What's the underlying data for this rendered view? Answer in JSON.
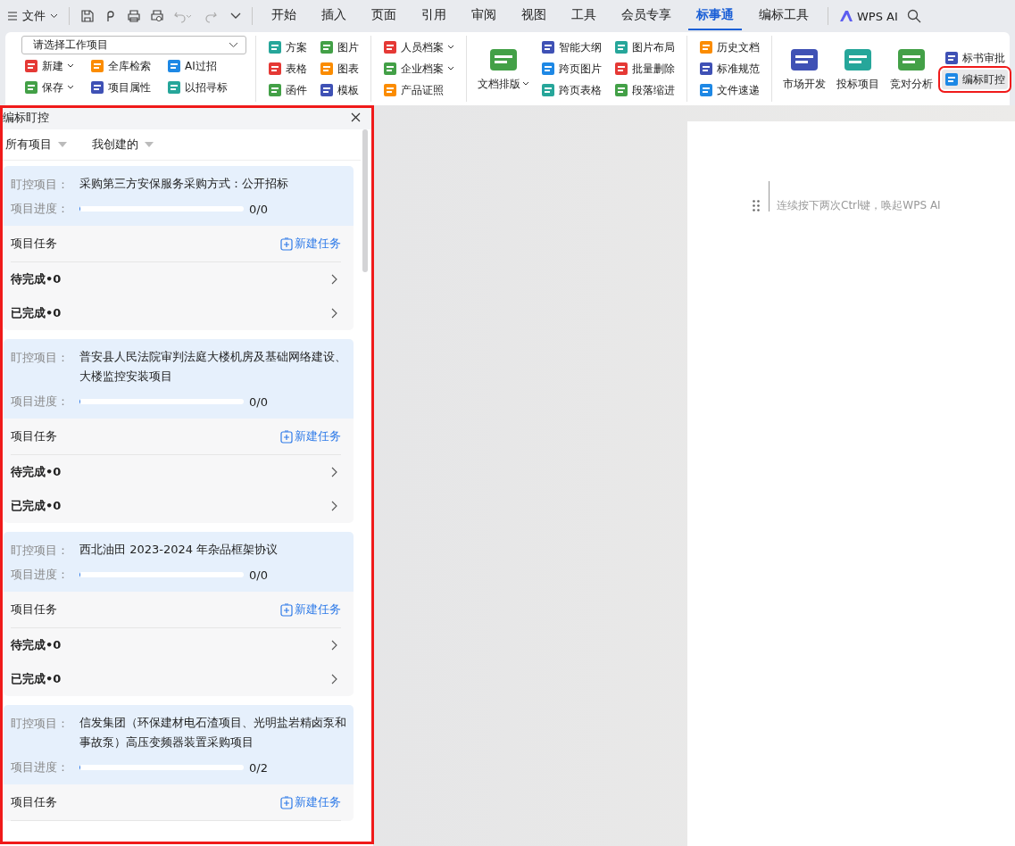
{
  "menu_bar": {
    "file_menu": "文件",
    "tabs": [
      {
        "label": "开始",
        "selected": false
      },
      {
        "label": "插入",
        "selected": false
      },
      {
        "label": "页面",
        "selected": false
      },
      {
        "label": "引用",
        "selected": false
      },
      {
        "label": "审阅",
        "selected": false
      },
      {
        "label": "视图",
        "selected": false
      },
      {
        "label": "工具",
        "selected": false
      },
      {
        "label": "会员专享",
        "selected": false
      },
      {
        "label": "标事通",
        "selected": true
      },
      {
        "label": "编标工具",
        "selected": false
      }
    ],
    "ai_button": "WPS AI"
  },
  "ribbon": {
    "groups": [
      {
        "columns": [
          [
            {
              "kind": "select",
              "label": "请选择工作项目"
            }
          ],
          [
            {
              "kind": "small",
              "label": "新建",
              "dropdown": true
            },
            {
              "kind": "small",
              "label": "保存",
              "dropdown": true
            }
          ],
          [
            {
              "kind": "small",
              "label": "全库检索",
              "dropdown": false
            },
            {
              "kind": "small",
              "label": "项目属性",
              "dropdown": false
            }
          ],
          [
            {
              "kind": "small",
              "label": "AI过招",
              "dropdown": false
            },
            {
              "kind": "small",
              "label": "以招寻标",
              "dropdown": false
            }
          ]
        ]
      },
      {
        "columns": [
          [
            {
              "kind": "small",
              "label": "方案",
              "dropdown": false
            },
            {
              "kind": "small",
              "label": "表格",
              "dropdown": false
            },
            {
              "kind": "small",
              "label": "函件",
              "dropdown": false
            }
          ],
          [
            {
              "kind": "small",
              "label": "图片",
              "dropdown": false
            },
            {
              "kind": "small",
              "label": "图表",
              "dropdown": false
            },
            {
              "kind": "small",
              "label": "模板",
              "dropdown": false
            }
          ]
        ]
      },
      {
        "columns": [
          [
            {
              "kind": "small",
              "label": "人员档案",
              "dropdown": true
            },
            {
              "kind": "small",
              "label": "企业档案",
              "dropdown": true
            },
            {
              "kind": "small",
              "label": "产品证照",
              "dropdown": false
            }
          ]
        ]
      },
      {
        "columns": [
          [
            {
              "kind": "big",
              "label": "文档排版",
              "dropdown": true,
              "selected": false
            }
          ],
          [
            {
              "kind": "small",
              "label": "智能大纲",
              "dropdown": false
            },
            {
              "kind": "small",
              "label": "跨页图片",
              "dropdown": false
            },
            {
              "kind": "small",
              "label": "跨页表格",
              "dropdown": false
            }
          ],
          [
            {
              "kind": "small",
              "label": "图片布局",
              "dropdown": false
            },
            {
              "kind": "small",
              "label": "批量删除",
              "dropdown": false
            },
            {
              "kind": "small",
              "label": "段落缩进",
              "dropdown": false
            }
          ]
        ]
      },
      {
        "columns": [
          [
            {
              "kind": "small",
              "label": "历史文档",
              "dropdown": false
            },
            {
              "kind": "small",
              "label": "标准规范",
              "dropdown": false
            },
            {
              "kind": "small",
              "label": "文件速递",
              "dropdown": false
            }
          ]
        ]
      },
      {
        "columns": [
          [
            {
              "kind": "big",
              "label": "市场开发",
              "dropdown": false,
              "selected": false
            }
          ],
          [
            {
              "kind": "big",
              "label": "投标项目",
              "dropdown": false,
              "selected": false
            }
          ],
          [
            {
              "kind": "big",
              "label": "竞对分析",
              "dropdown": false,
              "selected": false
            }
          ],
          [
            {
              "kind": "small",
              "label": "标书审批",
              "dropdown": false,
              "selected": false
            },
            {
              "kind": "small",
              "label": "编标盯控",
              "dropdown": false,
              "selected": true
            }
          ]
        ]
      }
    ]
  },
  "side_panel": {
    "title": "编标盯控",
    "filters": [
      {
        "label": "所有项目"
      },
      {
        "label": "我创建的"
      }
    ],
    "cards": [
      {
        "project_label": "盯控项目：",
        "project_name": "采购第三方安保服务采购方式：公开招标",
        "progress_label": "项目进度：",
        "level": 0,
        "progress_count": "0/0",
        "tasks_label": "项目任务",
        "new_task": "新建任务",
        "statuses": [
          {
            "label": "待完成•0"
          },
          {
            "label": "已完成•0"
          }
        ]
      },
      {
        "project_label": "盯控项目：",
        "project_name": "普安县人民法院审判法庭大楼机房及基础网络建设、大楼监控安装项目",
        "progress_label": "项目进度：",
        "level": 0,
        "progress_count": "0/0",
        "tasks_label": "项目任务",
        "new_task": "新建任务",
        "statuses": [
          {
            "label": "待完成•0"
          },
          {
            "label": "已完成•0"
          }
        ]
      },
      {
        "project_label": "盯控项目：",
        "project_name": "西北油田 2023-2024 年杂品框架协议",
        "progress_label": "项目进度：",
        "level": 0,
        "progress_count": "0/0",
        "tasks_label": "项目任务",
        "new_task": "新建任务",
        "statuses": [
          {
            "label": "待完成•0"
          },
          {
            "label": "已完成•0"
          }
        ]
      },
      {
        "project_label": "盯控项目：",
        "project_name": "信发集团（环保建材电石渣项目、光明盐岩精卤泵和事故泵）高压变频器装置采购项目",
        "progress_label": "项目进度：",
        "level": 0,
        "progress_count": "0/2",
        "tasks_label": "项目任务",
        "new_task": "新建任务"
      }
    ]
  },
  "document": {
    "placeholder": "连续按下两次Ctrl键，唤起WPS AI"
  }
}
